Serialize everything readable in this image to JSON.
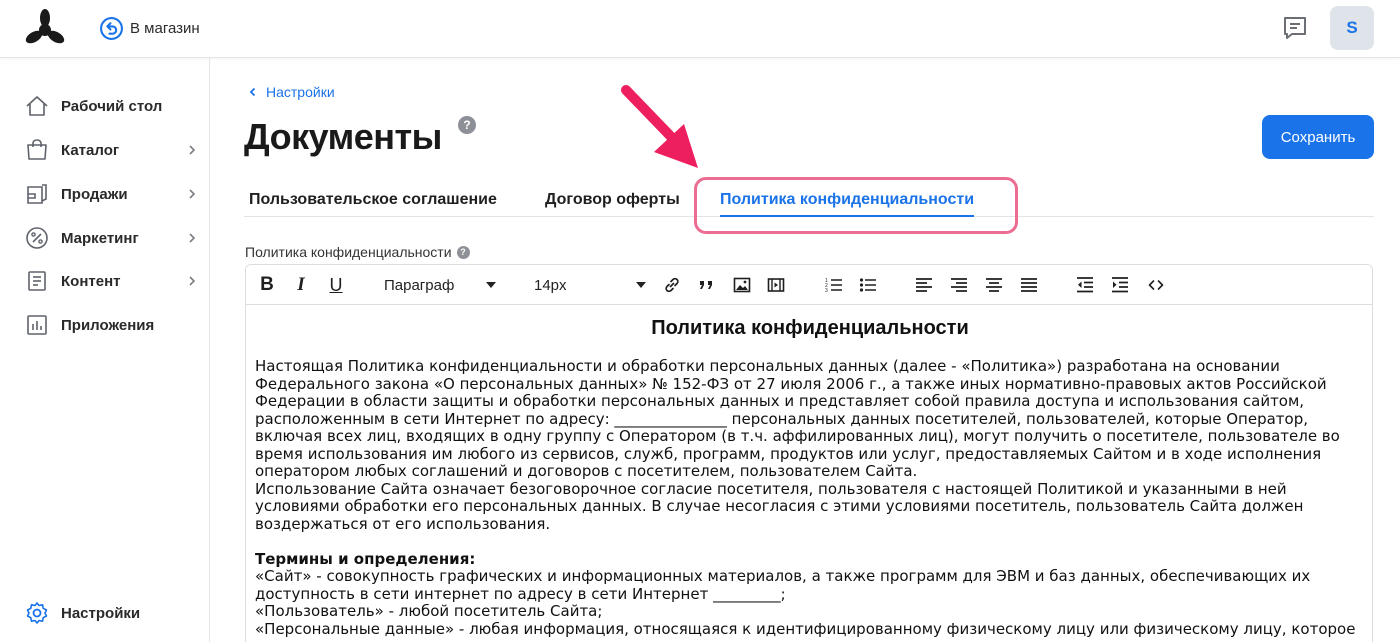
{
  "topbar": {
    "store_link": "В магазин",
    "avatar_letter": "S",
    "icons": [
      "logo-icon",
      "back-circle-icon",
      "chat-icon"
    ]
  },
  "sidebar": {
    "items": [
      {
        "label": "Рабочий стол",
        "icon": "home-icon",
        "has_submenu": false
      },
      {
        "label": "Каталог",
        "icon": "bag-icon",
        "has_submenu": true
      },
      {
        "label": "Продажи",
        "icon": "sales-icon",
        "has_submenu": true
      },
      {
        "label": "Маркетинг",
        "icon": "percent-icon",
        "has_submenu": true
      },
      {
        "label": "Контент",
        "icon": "content-icon",
        "has_submenu": true
      },
      {
        "label": "Приложения",
        "icon": "apps-icon",
        "has_submenu": false
      }
    ],
    "settings": {
      "label": "Настройки",
      "icon": "gear-icon",
      "color": "#1a73e8"
    }
  },
  "main": {
    "breadcrumb": "Настройки",
    "title": "Документы",
    "save_button": "Сохранить",
    "tabs": [
      {
        "label": "Пользовательское соглашение",
        "active": false
      },
      {
        "label": "Договор оферты",
        "active": false
      },
      {
        "label": "Политика конфиденциальности",
        "active": true
      }
    ],
    "field_label": "Политика конфиденциальности"
  },
  "toolbar": {
    "paragraph_select": "Параграф",
    "font_size_select": "14px"
  },
  "document": {
    "title": "Политика конфиденциальности",
    "intro_lines": [
      "Настоящая Политика конфиденциальности и обработки персональных данных (далее - «Политика») разработана на основании",
      "Федерального закона «О персональных данных» № 152-ФЗ от 27 июля 2006 г., а также иных нормативно-правовых актов Российской",
      "Федерации в области защиты и обработки персональных данных и представляет собой правила доступа и использования сайтом,",
      "расположенным в сети Интернет по адресу: _______________ персональных данных посетителей, пользователей, которые Оператор,",
      "включая всех лиц, входящих в одну группу с Оператором (в т.ч. аффилированных лиц), могут получить о посетителе, пользователе во",
      "время использования им любого из сервисов, служб, программ, продуктов или услуг, предоставляемых Сайтом и в ходе исполнения",
      "оператором любых соглашений и договоров с посетителем, пользователем Сайта.",
      "Использование Сайта означает безоговорочное согласие посетителя, пользователя с настоящей Политикой и указанными в ней",
      "условиями обработки его персональных данных. В случае несогласия с этими условиями посетитель, пользователь Сайта должен",
      "воздержаться от его использования."
    ],
    "terms_heading": "Термины и определения:",
    "terms_lines": [
      "«Сайт» - совокупность графических и информационных материалов, а также программ для ЭВМ и баз данных, обеспечивающих их",
      "доступность в сети интернет по адресу в сети Интернет _________;",
      "«Пользователь» - любой посетитель Сайта;",
      "«Персональные данные» - любая информация, относящаяся к идентифицированному физическому лицу или физическому лицу, которое"
    ]
  },
  "colors": {
    "accent": "#1a73e8",
    "highlight": "#ec6d92",
    "arrow": "#ee1f5f"
  }
}
